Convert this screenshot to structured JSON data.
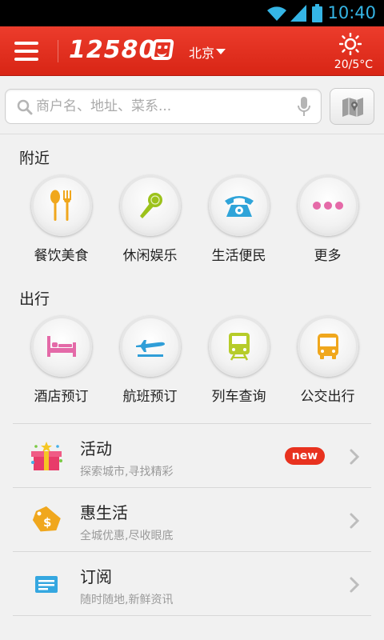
{
  "status_bar": {
    "time": "10:40"
  },
  "header": {
    "logo_text": "12580",
    "city": "北京",
    "temperature": "20/5°C",
    "brand_color": "#e33222"
  },
  "search": {
    "placeholder": "商户名、地址、菜系..."
  },
  "nearby": {
    "title": "附近",
    "items": [
      {
        "label": "餐饮美食",
        "icon": "fork-spoon-icon",
        "color": "#f0a71d"
      },
      {
        "label": "休闲娱乐",
        "icon": "microphone-icon",
        "color": "#9cc21b"
      },
      {
        "label": "生活便民",
        "icon": "telephone-icon",
        "color": "#2fa4d9"
      },
      {
        "label": "更多",
        "icon": "more-dots-icon",
        "color": "#e56aa8"
      }
    ]
  },
  "travel": {
    "title": "出行",
    "items": [
      {
        "label": "酒店预订",
        "icon": "bed-icon",
        "color": "#e46aa8"
      },
      {
        "label": "航班预订",
        "icon": "airplane-icon",
        "color": "#2f9ed8"
      },
      {
        "label": "列车查询",
        "icon": "train-icon",
        "color": "#b6cc2a"
      },
      {
        "label": "公交出行",
        "icon": "bus-icon",
        "color": "#f0a71d"
      }
    ]
  },
  "list": [
    {
      "title": "活动",
      "subtitle": "探索城市,寻找精彩",
      "badge": "new",
      "icon": "gift-box-icon"
    },
    {
      "title": "惠生活",
      "subtitle": "全城优惠,尽收眼底",
      "icon": "coupon-tag-icon"
    },
    {
      "title": "订阅",
      "subtitle": "随时随地,新鲜资讯",
      "icon": "newsletter-icon"
    }
  ]
}
